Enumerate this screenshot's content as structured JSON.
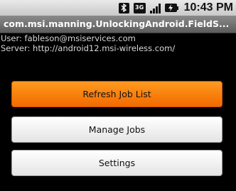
{
  "status_bar": {
    "icons": [
      "bluetooth-icon",
      "3g-icon",
      "signal-strength-icon",
      "battery-icon"
    ],
    "time": "10:43 PM"
  },
  "title_bar": {
    "title": "com.msi.manning.UnlockingAndroid.FieldS..."
  },
  "info": {
    "user": "User: fableson@msiservices.com",
    "server": "Server: http://android12.msi-wireless.com/"
  },
  "buttons": {
    "refresh": "Refresh Job List",
    "manage": "Manage Jobs",
    "settings": "Settings"
  },
  "colors": {
    "accent": "#f57d0d",
    "background": "#000000",
    "title_bar": "#6e6e6e"
  }
}
